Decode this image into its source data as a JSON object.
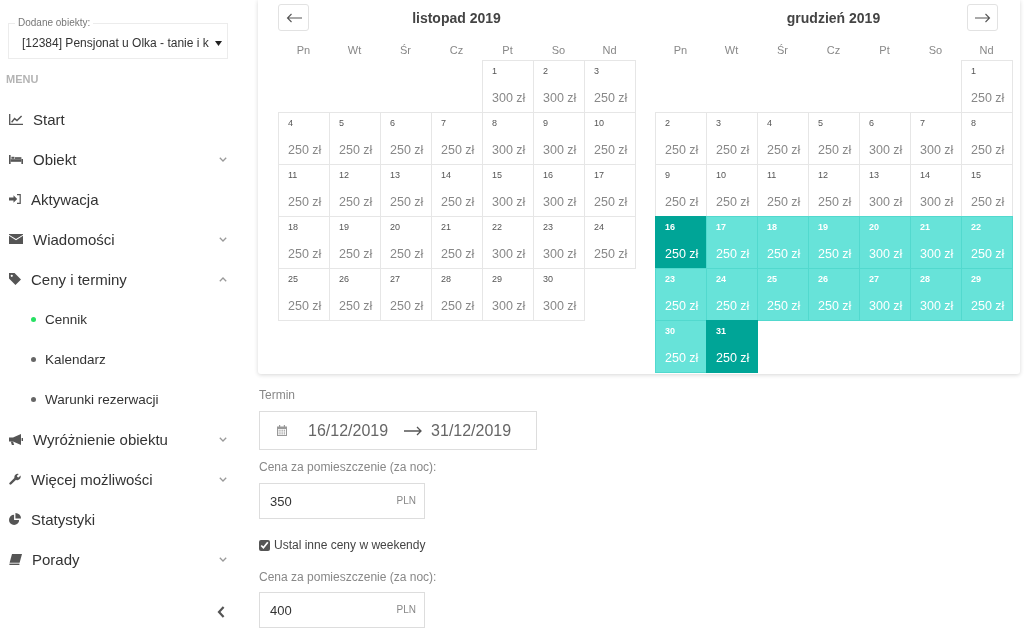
{
  "sidebar": {
    "object_select": {
      "label": "Dodane obiekty:",
      "value": "[12384] Pensjonat u Olka - tanie i k"
    },
    "menu_heading": "MENU",
    "items": [
      {
        "label": "Start",
        "kind": "link"
      },
      {
        "label": "Obiekt",
        "kind": "group",
        "expanded": false
      },
      {
        "label": "Aktywacja",
        "kind": "link"
      },
      {
        "label": "Wiadomości",
        "kind": "group",
        "expanded": false
      },
      {
        "label": "Ceny i terminy",
        "kind": "group",
        "expanded": true,
        "children": [
          {
            "label": "Cennik",
            "selected": true
          },
          {
            "label": "Kalendarz",
            "selected": false
          },
          {
            "label": "Warunki rezerwacji",
            "selected": false
          }
        ]
      },
      {
        "label": "Wyróżnienie obiektu",
        "kind": "group",
        "expanded": false
      },
      {
        "label": "Więcej możliwości",
        "kind": "group",
        "expanded": false
      },
      {
        "label": "Statystyki",
        "kind": "link"
      },
      {
        "label": "Porady",
        "kind": "group",
        "expanded": false
      }
    ]
  },
  "calendar": {
    "months": [
      {
        "title": "listopad 2019",
        "prev_button": true,
        "weekdays": [
          "Pn",
          "Wt",
          "Śr",
          "Cz",
          "Pt",
          "So",
          "Nd"
        ],
        "weeks": [
          {
            "days": [
              {
                "kind": "blank"
              },
              {
                "kind": "blank"
              },
              {
                "kind": "blank"
              },
              {
                "kind": "blank"
              },
              {
                "kind": "day",
                "day": "1",
                "price": "300 zł",
                "selected": false
              },
              {
                "kind": "day",
                "day": "2",
                "price": "300 zł",
                "selected": false
              },
              {
                "kind": "day",
                "day": "3",
                "price": "250 zł",
                "selected": false
              }
            ]
          },
          {
            "days": [
              {
                "kind": "day",
                "day": "4",
                "price": "250 zł",
                "selected": false
              },
              {
                "kind": "day",
                "day": "5",
                "price": "250 zł",
                "selected": false
              },
              {
                "kind": "day",
                "day": "6",
                "price": "250 zł",
                "selected": false
              },
              {
                "kind": "day",
                "day": "7",
                "price": "250 zł",
                "selected": false
              },
              {
                "kind": "day",
                "day": "8",
                "price": "300 zł",
                "selected": false
              },
              {
                "kind": "day",
                "day": "9",
                "price": "300 zł",
                "selected": false
              },
              {
                "kind": "day",
                "day": "10",
                "price": "250 zł",
                "selected": false
              }
            ]
          },
          {
            "days": [
              {
                "kind": "day",
                "day": "11",
                "price": "250 zł",
                "selected": false
              },
              {
                "kind": "day",
                "day": "12",
                "price": "250 zł",
                "selected": false
              },
              {
                "kind": "day",
                "day": "13",
                "price": "250 zł",
                "selected": false
              },
              {
                "kind": "day",
                "day": "14",
                "price": "250 zł",
                "selected": false
              },
              {
                "kind": "day",
                "day": "15",
                "price": "300 zł",
                "selected": false
              },
              {
                "kind": "day",
                "day": "16",
                "price": "300 zł",
                "selected": false
              },
              {
                "kind": "day",
                "day": "17",
                "price": "250 zł",
                "selected": false
              }
            ]
          },
          {
            "days": [
              {
                "kind": "day",
                "day": "18",
                "price": "250 zł",
                "selected": false
              },
              {
                "kind": "day",
                "day": "19",
                "price": "250 zł",
                "selected": false
              },
              {
                "kind": "day",
                "day": "20",
                "price": "250 zł",
                "selected": false
              },
              {
                "kind": "day",
                "day": "21",
                "price": "250 zł",
                "selected": false
              },
              {
                "kind": "day",
                "day": "22",
                "price": "300 zł",
                "selected": false
              },
              {
                "kind": "day",
                "day": "23",
                "price": "300 zł",
                "selected": false
              },
              {
                "kind": "day",
                "day": "24",
                "price": "250 zł",
                "selected": false
              }
            ]
          },
          {
            "days": [
              {
                "kind": "day",
                "day": "25",
                "price": "250 zł",
                "selected": false
              },
              {
                "kind": "day",
                "day": "26",
                "price": "250 zł",
                "selected": false
              },
              {
                "kind": "day",
                "day": "27",
                "price": "250 zł",
                "selected": false
              },
              {
                "kind": "day",
                "day": "28",
                "price": "250 zł",
                "selected": false
              },
              {
                "kind": "day",
                "day": "29",
                "price": "300 zł",
                "selected": false
              },
              {
                "kind": "day",
                "day": "30",
                "price": "300 zł",
                "selected": false
              }
            ]
          }
        ]
      },
      {
        "title": "grudzień 2019",
        "next_button": true,
        "weekdays": [
          "Pn",
          "Wt",
          "Śr",
          "Cz",
          "Pt",
          "So",
          "Nd"
        ],
        "weeks": [
          {
            "days": [
              {
                "kind": "blank"
              },
              {
                "kind": "blank"
              },
              {
                "kind": "blank"
              },
              {
                "kind": "blank"
              },
              {
                "kind": "blank"
              },
              {
                "kind": "blank"
              },
              {
                "kind": "day",
                "day": "1",
                "price": "250 zł",
                "selected": false
              }
            ]
          },
          {
            "days": [
              {
                "kind": "day",
                "day": "2",
                "price": "250 zł",
                "selected": false
              },
              {
                "kind": "day",
                "day": "3",
                "price": "250 zł",
                "selected": false
              },
              {
                "kind": "day",
                "day": "4",
                "price": "250 zł",
                "selected": false
              },
              {
                "kind": "day",
                "day": "5",
                "price": "250 zł",
                "selected": false
              },
              {
                "kind": "day",
                "day": "6",
                "price": "300 zł",
                "selected": false
              },
              {
                "kind": "day",
                "day": "7",
                "price": "300 zł",
                "selected": false
              },
              {
                "kind": "day",
                "day": "8",
                "price": "250 zł",
                "selected": false
              }
            ]
          },
          {
            "days": [
              {
                "kind": "day",
                "day": "9",
                "price": "250 zł",
                "selected": false
              },
              {
                "kind": "day",
                "day": "10",
                "price": "250 zł",
                "selected": false
              },
              {
                "kind": "day",
                "day": "11",
                "price": "250 zł",
                "selected": false
              },
              {
                "kind": "day",
                "day": "12",
                "price": "250 zł",
                "selected": false
              },
              {
                "kind": "day",
                "day": "13",
                "price": "300 zł",
                "selected": false
              },
              {
                "kind": "day",
                "day": "14",
                "price": "300 zł",
                "selected": false
              },
              {
                "kind": "day",
                "day": "15",
                "price": "250 zł",
                "selected": false
              }
            ]
          },
          {
            "days": [
              {
                "kind": "day",
                "day": "16",
                "price": "250 zł",
                "selected": true,
                "endpoint": true
              },
              {
                "kind": "day",
                "day": "17",
                "price": "250 zł",
                "selected": true,
                "endpoint": false
              },
              {
                "kind": "day",
                "day": "18",
                "price": "250 zł",
                "selected": true,
                "endpoint": false
              },
              {
                "kind": "day",
                "day": "19",
                "price": "250 zł",
                "selected": true,
                "endpoint": false
              },
              {
                "kind": "day",
                "day": "20",
                "price": "300 zł",
                "selected": true,
                "endpoint": false
              },
              {
                "kind": "day",
                "day": "21",
                "price": "300 zł",
                "selected": true,
                "endpoint": false
              },
              {
                "kind": "day",
                "day": "22",
                "price": "250 zł",
                "selected": true,
                "endpoint": false
              }
            ]
          },
          {
            "days": [
              {
                "kind": "day",
                "day": "23",
                "price": "250 zł",
                "selected": true,
                "endpoint": false
              },
              {
                "kind": "day",
                "day": "24",
                "price": "250 zł",
                "selected": true,
                "endpoint": false
              },
              {
                "kind": "day",
                "day": "25",
                "price": "250 zł",
                "selected": true,
                "endpoint": false
              },
              {
                "kind": "day",
                "day": "26",
                "price": "250 zł",
                "selected": true,
                "endpoint": false
              },
              {
                "kind": "day",
                "day": "27",
                "price": "300 zł",
                "selected": true,
                "endpoint": false
              },
              {
                "kind": "day",
                "day": "28",
                "price": "300 zł",
                "selected": true,
                "endpoint": false
              },
              {
                "kind": "day",
                "day": "29",
                "price": "250 zł",
                "selected": true,
                "endpoint": false
              }
            ]
          },
          {
            "days": [
              {
                "kind": "day",
                "day": "30",
                "price": "250 zł",
                "selected": true,
                "endpoint": false
              },
              {
                "kind": "day",
                "day": "31",
                "price": "250 zł",
                "selected": true,
                "endpoint": true
              }
            ]
          }
        ]
      }
    ]
  },
  "form": {
    "date_range": {
      "label": "Termin",
      "start": "16/12/2019",
      "end": "31/12/2019"
    },
    "room_price": {
      "label": "Cena za pomieszczenie (za noc):",
      "value": "350",
      "unit": "PLN"
    },
    "weekend_prices": {
      "label": "Ustal inne ceny w weekendy",
      "checked": true
    },
    "weekend_room_price": {
      "label": "Cena za pomieszczenie (za noc):",
      "value": "400",
      "unit": "PLN"
    }
  }
}
